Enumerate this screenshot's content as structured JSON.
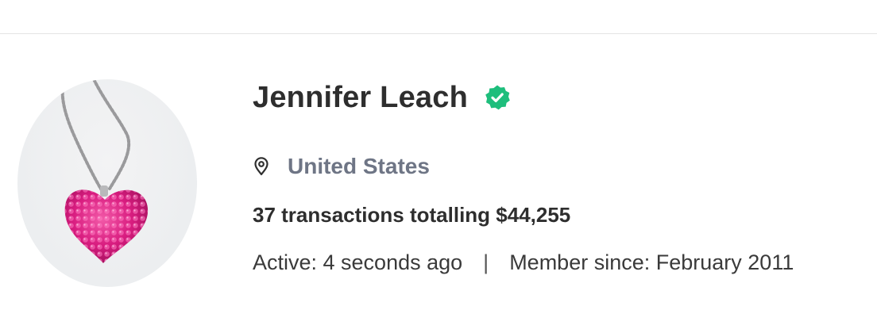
{
  "profile": {
    "name": "Jennifer Leach",
    "location": "United States",
    "stats": "37 transactions totalling $44,255",
    "active": "Active: 4 seconds ago",
    "separator": "|",
    "member_since": "Member since: February 2011"
  },
  "icons": {
    "verified": "verified-badge-icon",
    "location": "map-pin-icon"
  },
  "colors": {
    "verified_green": "#1ebe7c",
    "location_text": "#6e7585",
    "name_text": "#2e2e2e"
  }
}
